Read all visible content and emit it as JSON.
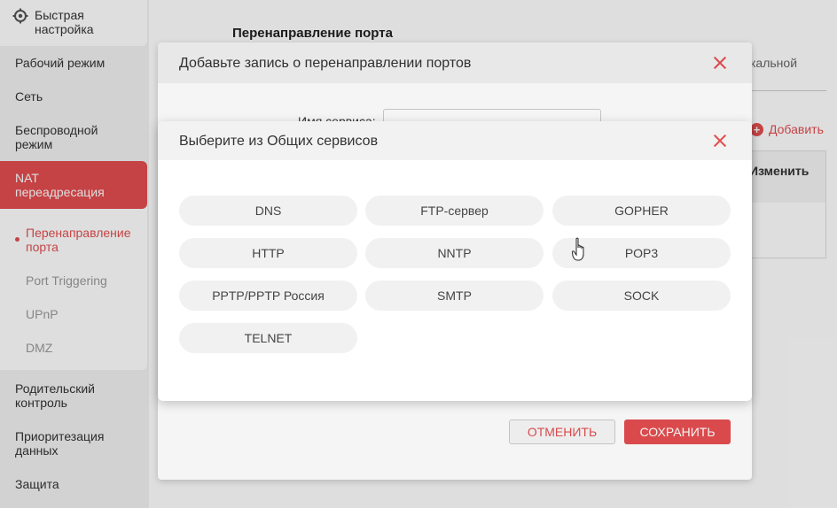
{
  "sidebar": {
    "quick_setup": "Быстрая настройка",
    "items": [
      {
        "label": "Рабочий режим"
      },
      {
        "label": "Сеть"
      },
      {
        "label": "Беспроводной режим"
      },
      {
        "label": "NAT переадресация"
      },
      {
        "label": "Родительский контроль"
      },
      {
        "label": "Приоритезация данных"
      },
      {
        "label": "Защита"
      }
    ],
    "nat_sub": [
      {
        "label": "Перенаправление порта",
        "active": true
      },
      {
        "label": "Port Triggering"
      },
      {
        "label": "UPnP"
      },
      {
        "label": "DMZ"
      }
    ]
  },
  "main": {
    "title": "Перенаправление порта",
    "tab_partial": "кальной",
    "add_label": "Добавить",
    "table_header": "Изменить"
  },
  "dialog_add": {
    "title": "Добавьте запись о перенаправлении портов",
    "service_name_label": "Имя сервиса:",
    "service_name_value": "",
    "cancel": "ОТМЕНИТЬ",
    "save": "СОХРАНИТЬ"
  },
  "dialog_services": {
    "title": "Выберите из Общих сервисов",
    "services": [
      "DNS",
      "FTP-сервер",
      "GOPHER",
      "HTTP",
      "NNTP",
      "POP3",
      "PPTP/PPTP Россия",
      "SMTP",
      "SOCK",
      "TELNET"
    ]
  },
  "colors": {
    "accent": "#e34e50",
    "sidebar_bg": "#f1f1f1",
    "pill_bg": "#f1f1f1"
  }
}
